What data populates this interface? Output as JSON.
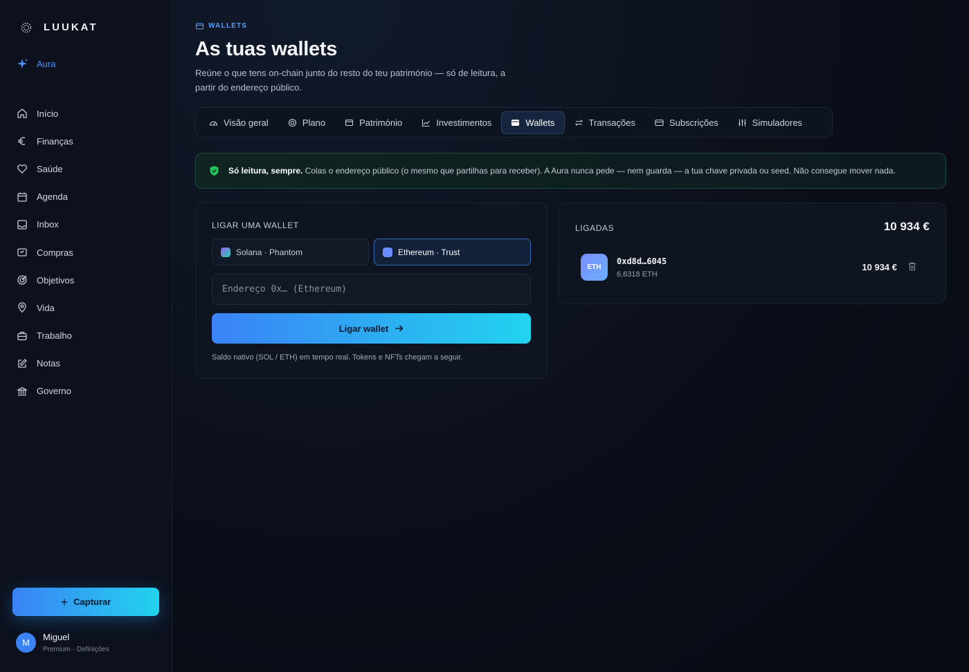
{
  "brand": {
    "name": "LUUKAT"
  },
  "sidebar": {
    "aura_label": "Aura",
    "items": [
      {
        "label": "Início",
        "icon": "home-icon"
      },
      {
        "label": "Finanças",
        "icon": "euro-icon"
      },
      {
        "label": "Saúde",
        "icon": "heart-icon"
      },
      {
        "label": "Agenda",
        "icon": "calendar-icon"
      },
      {
        "label": "Inbox",
        "icon": "inbox-icon"
      },
      {
        "label": "Compras",
        "icon": "cart-icon"
      },
      {
        "label": "Objetivos",
        "icon": "target-icon"
      },
      {
        "label": "Vida",
        "icon": "pin-icon"
      },
      {
        "label": "Trabalho",
        "icon": "briefcase-icon"
      },
      {
        "label": "Notas",
        "icon": "edit-icon"
      },
      {
        "label": "Governo",
        "icon": "bank-icon"
      }
    ],
    "capture_label": "Capturar",
    "user": {
      "initial": "M",
      "name": "Miguel",
      "sub": "Premium · Definições"
    }
  },
  "header": {
    "eyebrow": "WALLETS",
    "title": "As tuas wallets",
    "subtitle": "Reúne o que tens on-chain junto do resto do teu património — só de leitura, a partir do endereço público."
  },
  "tabs": [
    {
      "label": "Visão geral",
      "icon": "gauge-icon"
    },
    {
      "label": "Plano",
      "icon": "target-icon"
    },
    {
      "label": "Património",
      "icon": "wallet-icon"
    },
    {
      "label": "Investimentos",
      "icon": "chart-line-icon"
    },
    {
      "label": "Wallets",
      "icon": "wallet-icon",
      "active": true
    },
    {
      "label": "Transações",
      "icon": "swap-icon"
    },
    {
      "label": "Subscrições",
      "icon": "card-icon"
    },
    {
      "label": "Simuladores",
      "icon": "sliders-icon"
    }
  ],
  "notice": {
    "bold": "Só leitura, sempre.",
    "text": "Colas o endereço público (o mesmo que partilhas para receber). A Aura nunca pede — nem guarda — a tua chave privada ou seed. Não consegue mover nada."
  },
  "connect": {
    "label": "LIGAR UMA WALLET",
    "options": [
      "Solana · Phantom",
      "Ethereum · Trust"
    ],
    "selected": "Ethereum · Trust",
    "input_placeholder": "Endereço 0x… (Ethereum)",
    "input_value": "",
    "button_label": "Ligar wallet",
    "helper": "Saldo nativo (SOL / ETH) em tempo real. Tokens e NFTs chegam a seguir."
  },
  "linked": {
    "label": "LIGADAS",
    "total": "10 934 €",
    "wallets": [
      {
        "badge": "ETH",
        "address": "0xd8d…6045",
        "balance": "6,6318 ETH",
        "value": "10 934 €"
      }
    ]
  },
  "colors": {
    "accent": "#3b82f6",
    "accent_end": "#22d3ee",
    "success": "#22c55e"
  }
}
